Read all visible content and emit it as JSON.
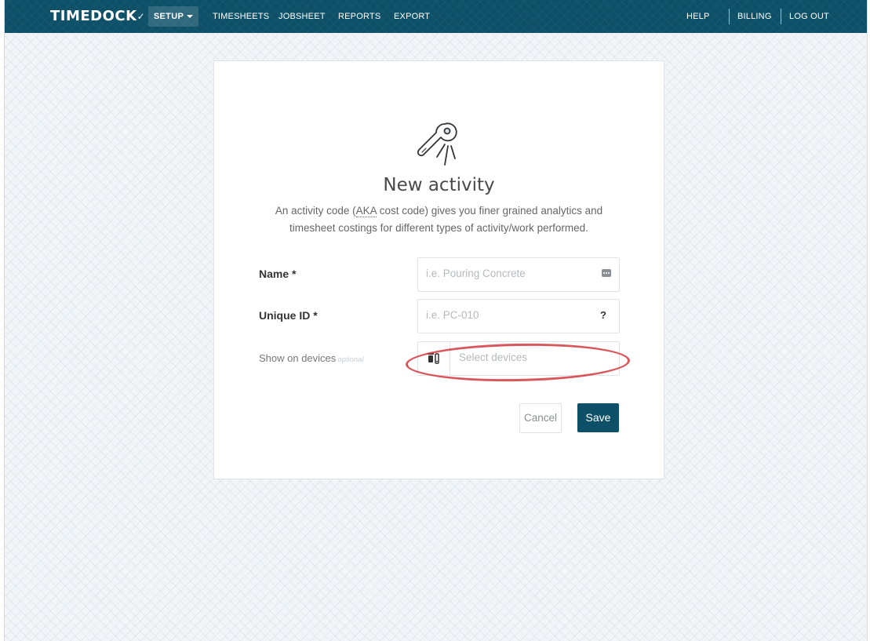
{
  "navbar": {
    "brand": "TIMEDOCK",
    "setup_label": "SETUP",
    "links": [
      "TIMESHEETS",
      "JOBSHEET",
      "REPORTS",
      "EXPORT"
    ],
    "right_links": [
      "HELP",
      "BILLING",
      "LOG OUT"
    ]
  },
  "card": {
    "title": "New activity",
    "desc_before_abbr": "An activity code (",
    "desc_abbr": "AKA",
    "desc_line1_rest": " cost code) gives you finer grained analytics and",
    "desc_line2": "timesheet costings for different types of activity/work performed."
  },
  "form": {
    "name_label": "Name *",
    "name_placeholder": "i.e. Pouring Concrete",
    "uid_label": "Unique ID *",
    "uid_placeholder": "i.e. PC-010",
    "uid_help": "?",
    "devices_label": "Show on devices",
    "devices_optional": "optional",
    "devices_placeholder": "Select devices",
    "cancel_label": "Cancel",
    "save_label": "Save"
  },
  "colors": {
    "navbar": "#0e5067",
    "save_button": "#0e5067",
    "highlight": "#d2383f",
    "background": "#f1f5f8"
  },
  "icons": [
    "wrench-icon",
    "caret-down-icon",
    "ellipsis-icon",
    "question-icon",
    "devices-icon"
  ]
}
